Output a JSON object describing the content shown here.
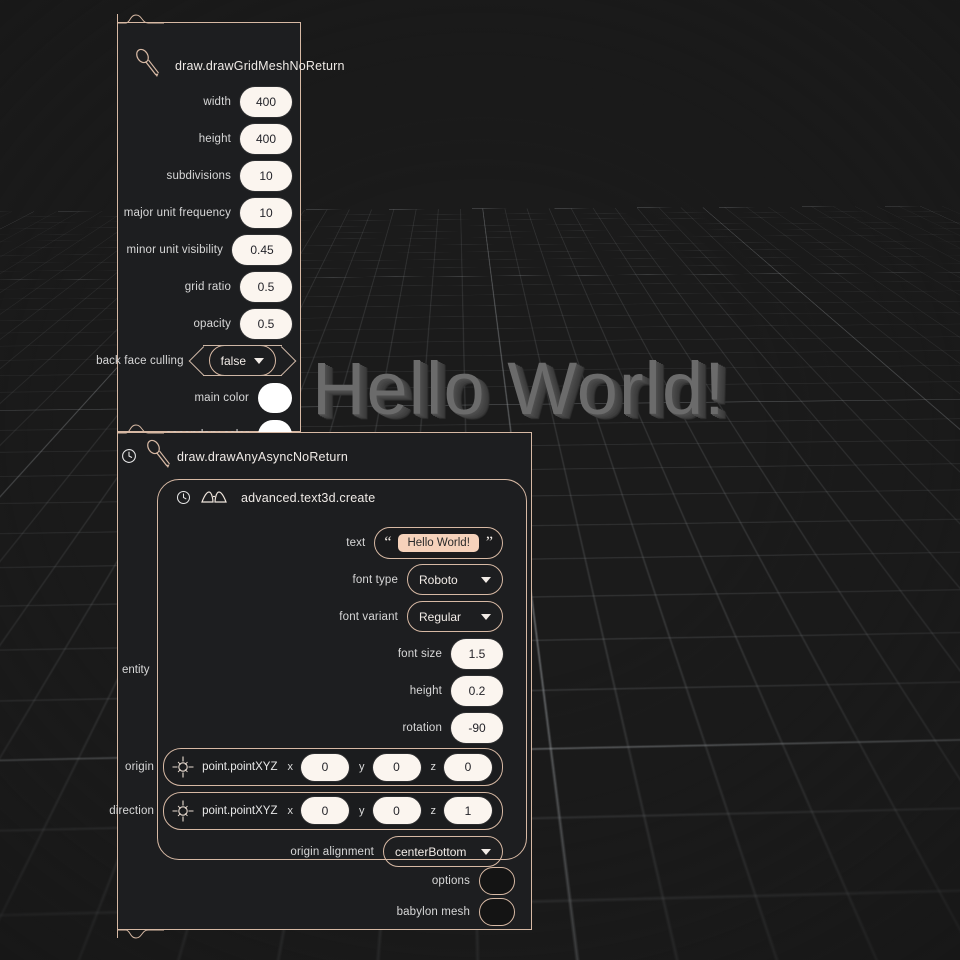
{
  "viewport": {
    "scene_text": "Hello World!",
    "background_color": "#1b1b1b",
    "grid_line_color": "#c8cdd2"
  },
  "accent_color": "#d7b9a4",
  "nodes": [
    {
      "id": "draw-grid-mesh",
      "title": "draw.drawGridMeshNoReturn",
      "icon": "brush-icon",
      "params": [
        {
          "label": "width",
          "value": "400",
          "kind": "number"
        },
        {
          "label": "height",
          "value": "400",
          "kind": "number"
        },
        {
          "label": "subdivisions",
          "value": "10",
          "kind": "number"
        },
        {
          "label": "major unit frequency",
          "value": "10",
          "kind": "number"
        },
        {
          "label": "minor unit visibility",
          "value": "0.45",
          "kind": "number"
        },
        {
          "label": "grid ratio",
          "value": "0.5",
          "kind": "number"
        },
        {
          "label": "opacity",
          "value": "0.5",
          "kind": "number"
        },
        {
          "label": "back face culling",
          "value": "false",
          "kind": "dropdown"
        },
        {
          "label": "main color",
          "value": "#ffffff",
          "kind": "color"
        },
        {
          "label": "secondary color",
          "value": "#ffffff",
          "kind": "color"
        }
      ]
    },
    {
      "id": "draw-any-async",
      "title": "draw.drawAnyAsyncNoReturn",
      "icon": "brush-icon",
      "badge_icon": "clock-icon",
      "input_label": "entity",
      "outputs": [
        {
          "label": "options",
          "kind": "socket"
        },
        {
          "label": "babylon mesh",
          "kind": "socket"
        }
      ],
      "inner_node": {
        "id": "text3d-create",
        "title": "advanced.text3d.create",
        "badge_icon": "clock-icon",
        "icon": "glasses-3d-icon",
        "params": [
          {
            "label": "text",
            "value": "Hello World!",
            "kind": "text",
            "quote_open": "“",
            "quote_close": "”"
          },
          {
            "label": "font type",
            "value": "Roboto",
            "kind": "dropdown"
          },
          {
            "label": "font variant",
            "value": "Regular",
            "kind": "dropdown"
          },
          {
            "label": "font size",
            "value": "1.5",
            "kind": "number"
          },
          {
            "label": "height",
            "value": "0.2",
            "kind": "number"
          },
          {
            "label": "rotation",
            "value": "-90",
            "kind": "number"
          },
          {
            "label": "origin",
            "kind": "xyz",
            "node_name": "point.pointXYZ",
            "icon": "crosshair-icon",
            "axes": [
              {
                "axis": "x",
                "value": "0"
              },
              {
                "axis": "y",
                "value": "0"
              },
              {
                "axis": "z",
                "value": "0"
              }
            ]
          },
          {
            "label": "direction",
            "kind": "xyz",
            "node_name": "point.pointXYZ",
            "icon": "crosshair-icon",
            "axes": [
              {
                "axis": "x",
                "value": "0"
              },
              {
                "axis": "y",
                "value": "0"
              },
              {
                "axis": "z",
                "value": "1"
              }
            ]
          },
          {
            "label": "origin alignment",
            "value": "centerBottom",
            "kind": "dropdown"
          }
        ]
      }
    }
  ]
}
